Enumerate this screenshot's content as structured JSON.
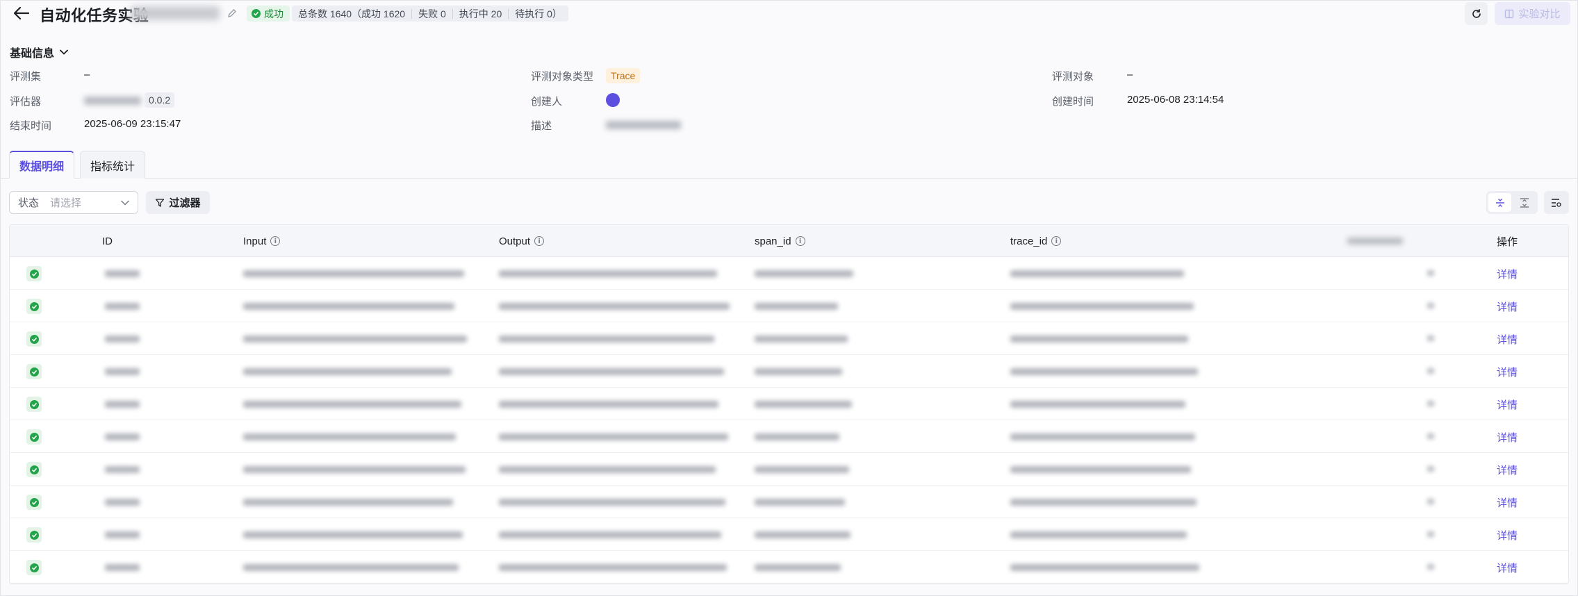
{
  "header": {
    "title": "自动化任务实验",
    "status": "成功",
    "stats": [
      "总条数 1640（成功 1620",
      "失败 0",
      "执行中 20",
      "待执行 0）"
    ],
    "compare_label": "实验对比"
  },
  "basic_info": {
    "section_title": "基础信息",
    "fields": {
      "eval_set_label": "评测集",
      "eval_set_value": "–",
      "target_type_label": "评测对象类型",
      "target_type_value": "Trace",
      "target_label": "评测对象",
      "target_value": "–",
      "evaluator_label": "评估器",
      "evaluator_version": "0.0.2",
      "creator_label": "创建人",
      "created_time_label": "创建时间",
      "created_time_value": "2025-06-08 23:14:54",
      "end_time_label": "结束时间",
      "end_time_value": "2025-06-09 23:15:47",
      "desc_label": "描述"
    }
  },
  "tabs": [
    {
      "label": "数据明细",
      "active": true
    },
    {
      "label": "指标统计",
      "active": false
    }
  ],
  "filters": {
    "status_label": "状态",
    "status_placeholder": "请选择",
    "filter_button": "过滤器"
  },
  "table": {
    "columns": {
      "id": "ID",
      "input": "Input",
      "output": "Output",
      "span_id": "span_id",
      "trace_id": "trace_id",
      "action": "操作"
    },
    "row_action": "详情",
    "row_status": "success",
    "row_count": 10
  },
  "colors": {
    "accent": "#5b4fe0",
    "success": "#23a44a",
    "trace_tag": "#c07419"
  }
}
